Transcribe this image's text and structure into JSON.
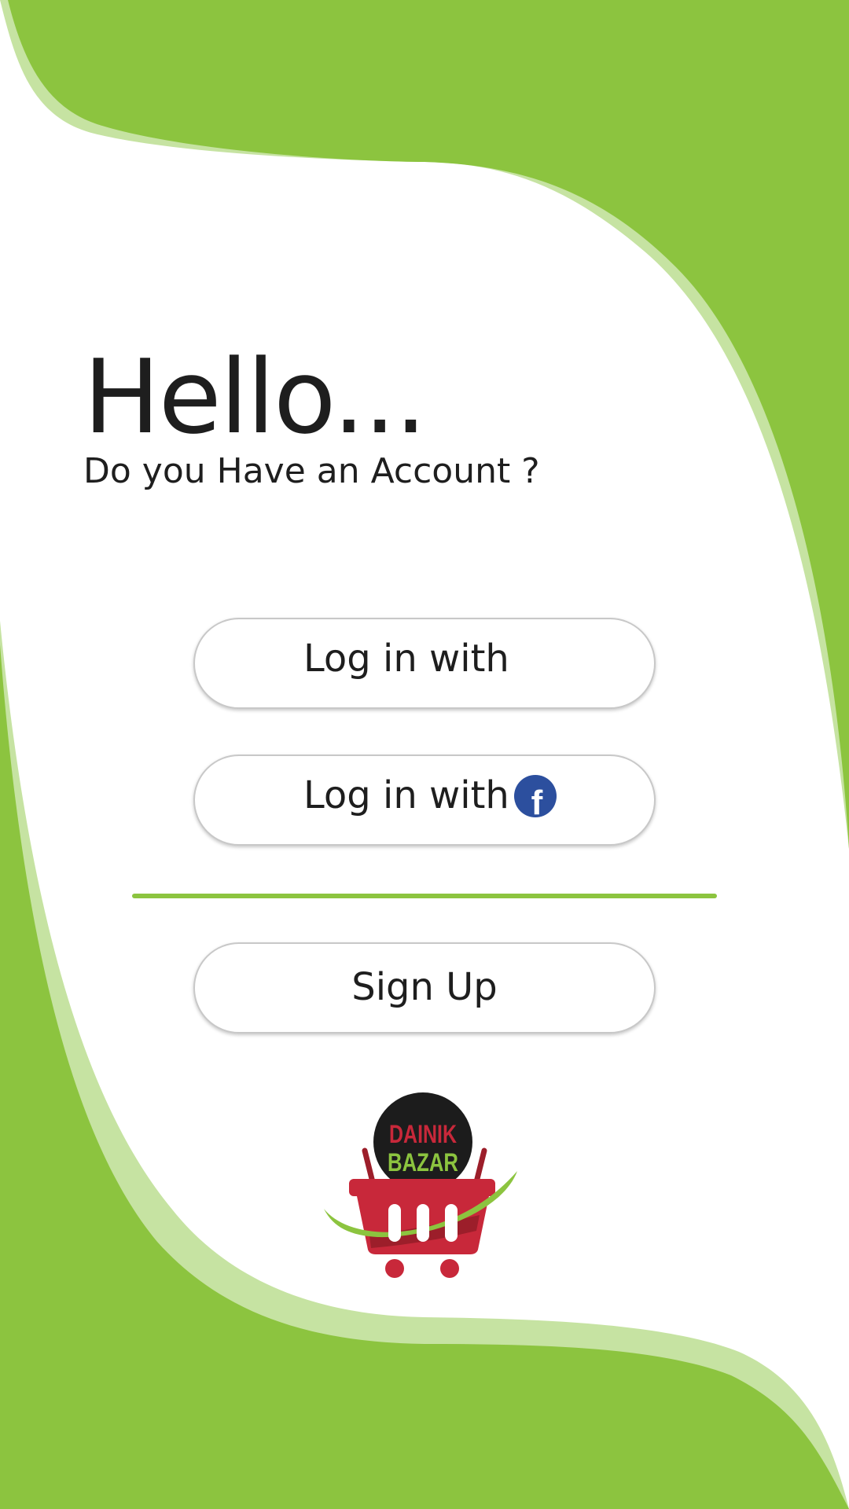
{
  "colors": {
    "brand_green": "#8cc43f",
    "light_green": "#c6e3a2",
    "logo_red": "#c8283a",
    "facebook_blue": "#2c4f9e"
  },
  "greeting": "Hello...",
  "subtitle": "Do you Have an Account ?",
  "login_google": {
    "label": "Log in with",
    "icon": "google-icon"
  },
  "login_facebook": {
    "label": "Log in with",
    "icon": "facebook-icon"
  },
  "signup": {
    "label": "Sign Up"
  },
  "logo": {
    "line1": "DAINIK",
    "line2": "BAZAR",
    "icon": "shopping-basket-icon"
  }
}
